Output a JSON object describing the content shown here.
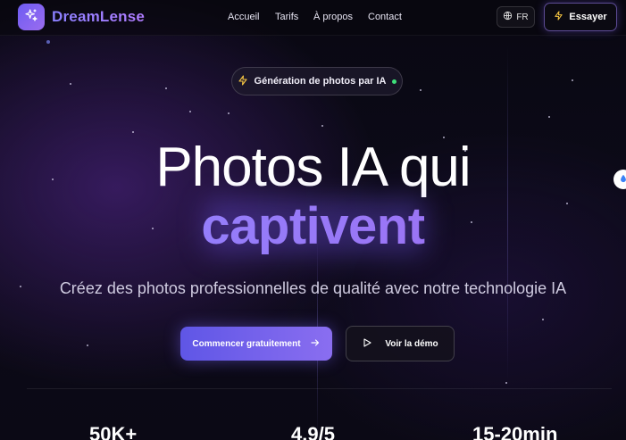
{
  "brand": {
    "name": "DreamLense",
    "icon": "sparkles-icon"
  },
  "nav": {
    "links": [
      "Accueil",
      "Tarifs",
      "À propos",
      "Contact"
    ],
    "lang_label": "FR",
    "lang_icon": "globe-icon",
    "cta_label": "Essayer",
    "cta_icon": "lightning-icon"
  },
  "badge": {
    "text": "Génération de photos par IA",
    "icon": "lightning-icon",
    "status_color": "#3ee07a"
  },
  "hero": {
    "title_line1": "Photos IA qui",
    "title_line2": "captivent",
    "subtitle": "Créez des photos professionnelles de qualité avec notre technologie IA"
  },
  "cta": {
    "primary_label": "Commencer gratuitement",
    "primary_icon": "arrow-right-icon",
    "secondary_label": "Voir la démo",
    "secondary_icon": "play-icon"
  },
  "stats": [
    "50K+",
    "4.9/5",
    "15-20min"
  ],
  "colors": {
    "accent": "#7a6cf0",
    "accent_alt": "#a06cf0",
    "background": "#0a0914"
  }
}
